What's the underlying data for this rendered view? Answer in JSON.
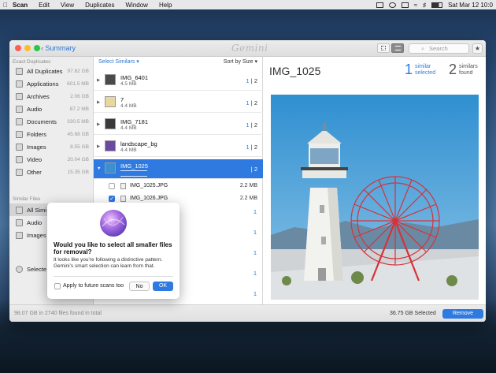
{
  "menubar": {
    "app": "Scan",
    "items": [
      "Edit",
      "View",
      "Duplicates",
      "Window",
      "Help"
    ],
    "clock": "Sat Mar 12  10:0"
  },
  "window": {
    "back_label": "Summary",
    "logo": "Gemini",
    "search_placeholder": "Search"
  },
  "sidebar": {
    "exact_header": "Exact Duplicates",
    "exact": [
      {
        "label": "All Duplicates",
        "size": "97.62 GB",
        "icon": "folder-icon"
      },
      {
        "label": "Applications",
        "size": "601.5 MB",
        "icon": "applications-icon"
      },
      {
        "label": "Archives",
        "size": "2.06 GB",
        "icon": "archive-icon"
      },
      {
        "label": "Audio",
        "size": "87.2 MB",
        "icon": "music-note-icon"
      },
      {
        "label": "Documents",
        "size": "330.5 MB",
        "icon": "document-icon"
      },
      {
        "label": "Folders",
        "size": "45.68 GB",
        "icon": "folder-icon"
      },
      {
        "label": "Images",
        "size": "8.55 GB",
        "icon": "image-icon"
      },
      {
        "label": "Video",
        "size": "20.04 GB",
        "icon": "video-icon"
      },
      {
        "label": "Other",
        "size": "15.35 GB",
        "icon": "file-icon"
      }
    ],
    "similar_header": "Similar Files",
    "similar": [
      {
        "label": "All Simi",
        "icon": "folder-icon"
      },
      {
        "label": "Audio",
        "icon": "music-note-icon"
      },
      {
        "label": "Images",
        "icon": "image-icon"
      }
    ],
    "bottom_item": "Selecte"
  },
  "list": {
    "select_label": "Select Similars ▾",
    "sort_label": "Sort by Size ▾",
    "rows": [
      {
        "name": "IMG_6401",
        "size": "4.5 MB",
        "sel": "1",
        "total": "2"
      },
      {
        "name": "7",
        "size": "4.4 MB",
        "sel": "1",
        "total": "2"
      },
      {
        "name": "IMG_7181",
        "size": "4.4 MB",
        "sel": "1",
        "total": "2"
      },
      {
        "name": "landscape_bg",
        "size": "4.4 MB",
        "sel": "1",
        "total": "2"
      },
      {
        "name": "IMG_1025",
        "size": "",
        "sel": "1",
        "total": "2"
      }
    ],
    "files": [
      {
        "name": "IMG_1025.JPG",
        "size": "2.2 MB",
        "checked": false
      },
      {
        "name": "IMG_1026.JPG",
        "size": "2.2 MB",
        "checked": true
      }
    ],
    "partial": [
      "1",
      "1",
      "1",
      "1",
      "1",
      "1"
    ],
    "separator": "|",
    "check_glyph": "✓"
  },
  "detail": {
    "title": "IMG_1025",
    "similar_selected_count": "1",
    "similar_selected_label": "similar selected",
    "similars_found_count": "2",
    "similars_found_label": "similars found"
  },
  "footer": {
    "left": "98.07 GB in 2740 files found in total",
    "right": "36.75 GB Selected",
    "remove": "Remove"
  },
  "popover": {
    "question": "Would you like to select all smaller files for removal?",
    "description": "It looks like you’re following a distinctive pattern. Gemini’s smart selection can learn from that.",
    "apply_label": "Apply to future scans too",
    "no": "No",
    "ok": "OK"
  },
  "colors": {
    "accent": "#2f7ae0",
    "close": "#fc5f57",
    "minimize": "#fdbc2e",
    "zoom": "#28c840"
  }
}
